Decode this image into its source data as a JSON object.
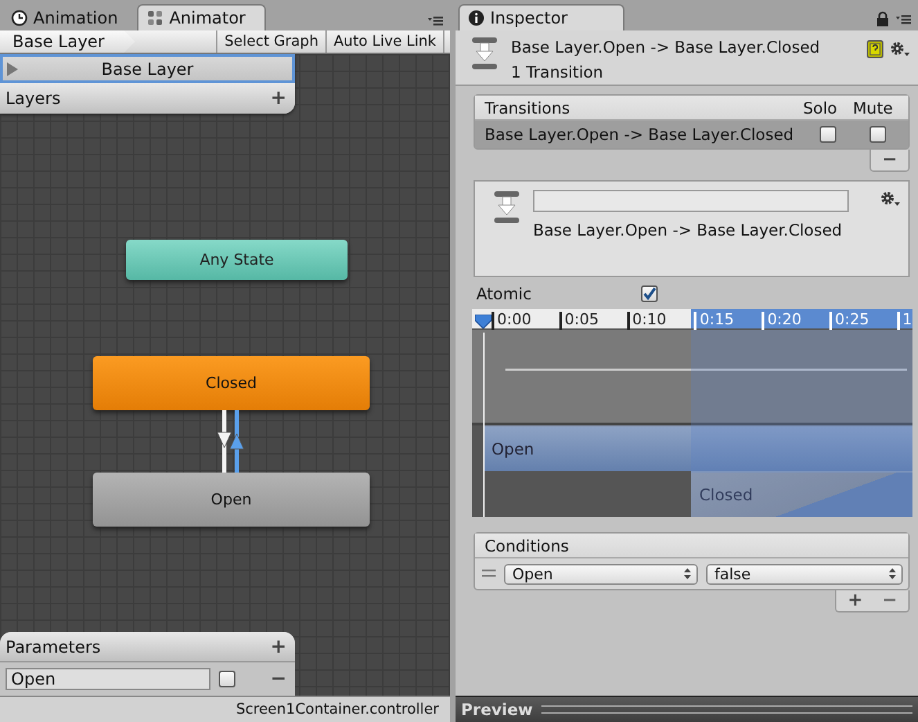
{
  "animator": {
    "tabs": [
      {
        "label": "Animation",
        "selected": false,
        "kind": "clock"
      },
      {
        "label": "Animator",
        "selected": true,
        "kind": "nodes"
      }
    ],
    "breadcrumb": "Base Layer",
    "toolbar_buttons": [
      "Select Graph",
      "Auto Live Link"
    ],
    "layers": {
      "title": "Layers",
      "add": "+",
      "items": [
        {
          "name": "Base Layer",
          "selected": true
        }
      ]
    },
    "states": [
      {
        "name": "Any State",
        "kind": "any"
      },
      {
        "name": "Closed",
        "kind": "default"
      },
      {
        "name": "Open",
        "kind": "normal"
      }
    ],
    "transitions": [
      {
        "kind": "down",
        "selected": false
      },
      {
        "kind": "up",
        "selected": true
      }
    ],
    "parameters": {
      "title": "Parameters",
      "add": "+",
      "remove": "−",
      "items": [
        {
          "name": "Open",
          "checked": false
        }
      ]
    },
    "status_bar": "Screen1Container.controller"
  },
  "inspector": {
    "tab": "Inspector",
    "title": "Base Layer.Open -> Base Layer.Closed",
    "subtitle": "1 Transition",
    "transition_list": {
      "columns": [
        "Transitions",
        "Solo",
        "Mute"
      ],
      "remove": "−",
      "rows": [
        {
          "name": "Base Layer.Open -> Base Layer.Closed",
          "solo": false,
          "mute": false,
          "selected": true
        }
      ]
    },
    "transition": {
      "label": "Base Layer.Open -> Base Layer.Closed"
    },
    "atomic": {
      "label": "Atomic",
      "checked": true
    },
    "timeline": {
      "ticks": [
        "0:00",
        "0:05",
        "0:10",
        "0:15",
        "0:20",
        "0:25",
        "1"
      ],
      "clips": [
        {
          "name": "Open",
          "kind": "source"
        },
        {
          "name": "Closed",
          "kind": "destination"
        }
      ]
    },
    "conditions": {
      "title": "Conditions",
      "add": "+",
      "remove": "−",
      "rows": [
        {
          "parameter": "Open",
          "value": "false"
        }
      ]
    },
    "preview": "Preview"
  }
}
